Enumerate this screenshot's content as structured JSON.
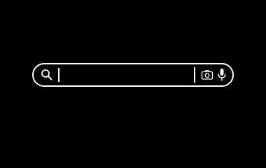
{
  "search": {
    "value": "",
    "placeholder": ""
  },
  "icons": {
    "search": "search-icon",
    "camera": "camera-icon",
    "microphone": "microphone-icon"
  },
  "colors": {
    "background": "#000000",
    "foreground": "#ffffff"
  }
}
